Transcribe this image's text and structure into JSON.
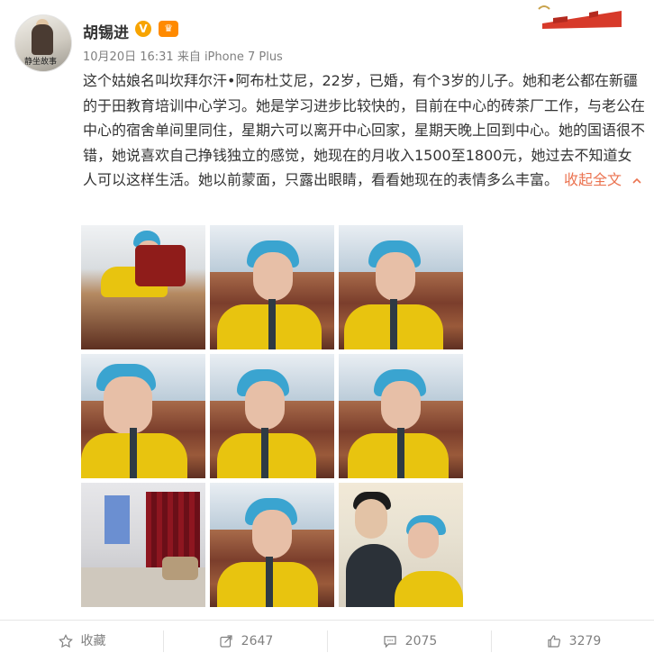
{
  "post": {
    "username": "胡锡进",
    "verified_badge": "V",
    "member_badge": "♛",
    "meta": "10月20日 16:31 来自 iPhone 7 Plus",
    "text": "这个姑娘名叫坎拜尔汗•阿布杜艾尼，22岁，已婚，有个3岁的儿子。她和老公都在新疆的于田教育培训中心学习。她是学习进步比较快的，目前在中心的砖茶厂工作，与老公在中心的宿舍单间里同住，星期六可以离开中心回家，星期天晚上回到中心。她的国语很不错，她说喜欢自己挣钱独立的感觉，她现在的月收入1500至1800元，她过去不知道女人可以这样生活。她以前蒙面，只露出眼睛，看看她现在的表情多么丰富。",
    "collapse_label": "收起全文",
    "collapse_icon": "chevron-up-icon",
    "avatar_caption": "静坐故事"
  },
  "photos": [
    {
      "name": "photo-1",
      "kind": "worker-side"
    },
    {
      "name": "photo-2",
      "kind": "worker"
    },
    {
      "name": "photo-3",
      "kind": "worker"
    },
    {
      "name": "photo-4",
      "kind": "worker"
    },
    {
      "name": "photo-5",
      "kind": "worker"
    },
    {
      "name": "photo-6",
      "kind": "worker"
    },
    {
      "name": "photo-7",
      "kind": "room"
    },
    {
      "name": "photo-8",
      "kind": "worker"
    },
    {
      "name": "photo-9",
      "kind": "man"
    }
  ],
  "actions": {
    "favorite": {
      "label": "收藏",
      "icon": "star-icon"
    },
    "repost": {
      "label": "2647",
      "icon": "share-icon"
    },
    "comment": {
      "label": "2075",
      "icon": "comment-icon"
    },
    "like": {
      "label": "3279",
      "icon": "thumbs-up-icon"
    }
  },
  "colors": {
    "accent": "#eb7350",
    "text": "#333333",
    "muted": "#808080",
    "badge_v": "#f7a401",
    "divider": "#e6e6e6"
  }
}
